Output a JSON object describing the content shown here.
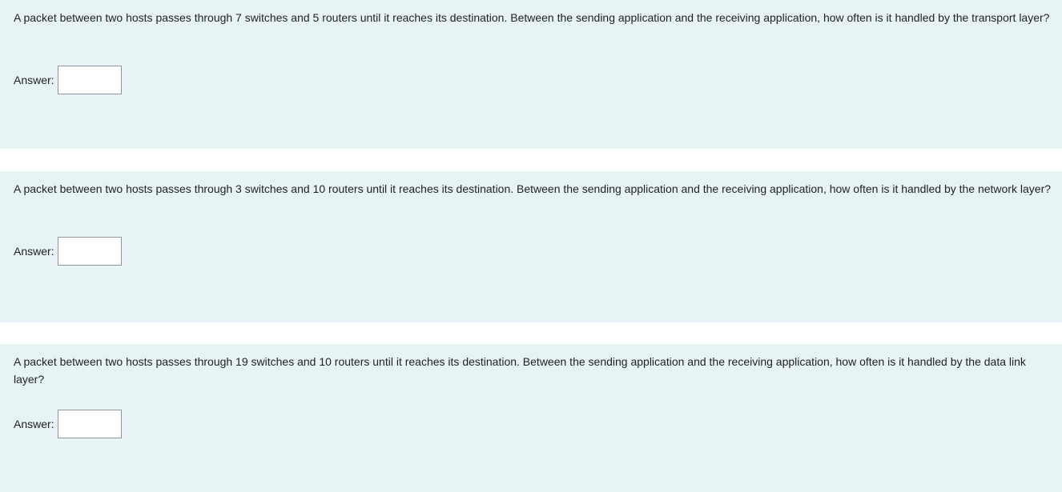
{
  "questions": [
    {
      "text": "A packet between two hosts passes through 7 switches and 5 routers until it reaches its destination. Between the sending application and the receiving application, how often is it handled by the transport layer?",
      "answer_label": "Answer:",
      "answer_value": ""
    },
    {
      "text": "A packet between two hosts passes through 3 switches and 10 routers until it reaches its destination. Between the sending application and the receiving application, how often is it handled by the network layer?",
      "answer_label": "Answer:",
      "answer_value": ""
    },
    {
      "text": "A packet between two hosts passes through 19 switches and 10 routers until it reaches its destination. Between the sending application and the receiving application, how often is it handled by the data link layer?",
      "answer_label": "Answer:",
      "answer_value": ""
    }
  ]
}
